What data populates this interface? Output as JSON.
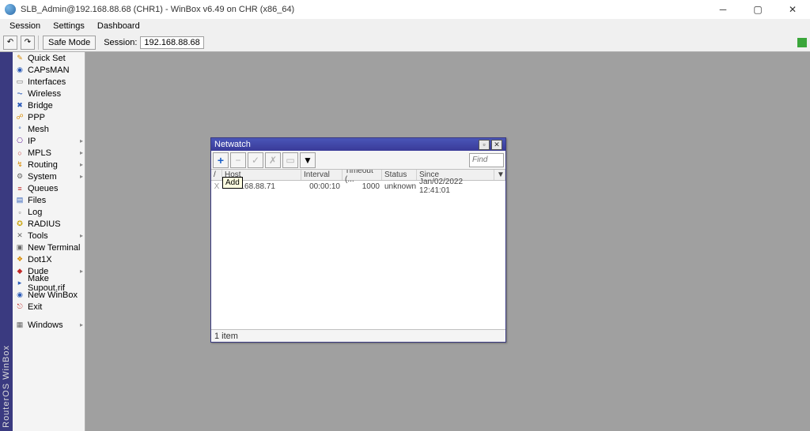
{
  "window": {
    "title": "SLB_Admin@192.168.88.68 (CHR1) - WinBox v6.49 on CHR (x86_64)"
  },
  "menu": {
    "items": [
      "Session",
      "Settings",
      "Dashboard"
    ]
  },
  "toolbar": {
    "safe_mode": "Safe Mode",
    "session_label": "Session:",
    "session_value": "192.168.88.68"
  },
  "brand": "RouterOS WinBox",
  "sidebar": {
    "items": [
      {
        "label": "Quick Set",
        "icon": "✎",
        "cls": "ic-orange",
        "arrow": false
      },
      {
        "label": "CAPsMAN",
        "icon": "◉",
        "cls": "ic-blue",
        "arrow": false
      },
      {
        "label": "Interfaces",
        "icon": "▭",
        "cls": "ic-gray",
        "arrow": false
      },
      {
        "label": "Wireless",
        "icon": "⏦",
        "cls": "ic-blue",
        "arrow": false
      },
      {
        "label": "Bridge",
        "icon": "✖",
        "cls": "ic-blue",
        "arrow": false
      },
      {
        "label": "PPP",
        "icon": "☍",
        "cls": "ic-orange",
        "arrow": false
      },
      {
        "label": "Mesh",
        "icon": "°",
        "cls": "ic-blue",
        "arrow": false
      },
      {
        "label": "IP",
        "icon": "⎔",
        "cls": "ic-purple",
        "arrow": true
      },
      {
        "label": "MPLS",
        "icon": "○",
        "cls": "ic-red",
        "arrow": true
      },
      {
        "label": "Routing",
        "icon": "↯",
        "cls": "ic-orange",
        "arrow": true
      },
      {
        "label": "System",
        "icon": "⚙",
        "cls": "ic-gray",
        "arrow": true
      },
      {
        "label": "Queues",
        "icon": "≡",
        "cls": "ic-red",
        "arrow": false
      },
      {
        "label": "Files",
        "icon": "▤",
        "cls": "ic-blue",
        "arrow": false
      },
      {
        "label": "Log",
        "icon": "▫",
        "cls": "ic-gray",
        "arrow": false
      },
      {
        "label": "RADIUS",
        "icon": "✪",
        "cls": "ic-yellow",
        "arrow": false
      },
      {
        "label": "Tools",
        "icon": "✕",
        "cls": "ic-gray",
        "arrow": true
      },
      {
        "label": "New Terminal",
        "icon": "▣",
        "cls": "ic-gray",
        "arrow": false
      },
      {
        "label": "Dot1X",
        "icon": "❖",
        "cls": "ic-orange",
        "arrow": false
      },
      {
        "label": "Dude",
        "icon": "◆",
        "cls": "ic-red",
        "arrow": true
      },
      {
        "label": "Make Supout.rif",
        "icon": "▸",
        "cls": "ic-blue",
        "arrow": false
      },
      {
        "label": "New WinBox",
        "icon": "◉",
        "cls": "ic-blue",
        "arrow": false
      },
      {
        "label": "Exit",
        "icon": "⎋",
        "cls": "ic-red",
        "arrow": false
      }
    ],
    "windows_label": "Windows"
  },
  "netwatch": {
    "title": "Netwatch",
    "find_placeholder": "Find",
    "tooltip_add": "Add",
    "columns": {
      "flag": "/",
      "host": "Host",
      "interval": "Interval",
      "timeout": "Timeout (...",
      "status": "Status",
      "since": "Since"
    },
    "rows": [
      {
        "flag": "X",
        "host": "192.168.88.71",
        "interval": "00:00:10",
        "timeout": "1000",
        "status": "unknown",
        "since": "Jan/02/2022 12:41:01"
      }
    ],
    "status": "1 item"
  }
}
